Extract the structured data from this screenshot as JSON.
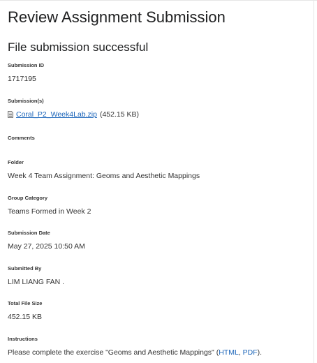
{
  "page": {
    "title": "Review Assignment Submission",
    "subtitle": "File submission successful"
  },
  "submission_id": {
    "label": "Submission ID",
    "value": "1717195"
  },
  "submissions": {
    "label": "Submission(s)",
    "file_icon": "file-icon",
    "file_name": "Coral_P2_Week4Lab.zip",
    "file_size": "(452.15 KB)"
  },
  "comments": {
    "label": "Comments"
  },
  "folder": {
    "label": "Folder",
    "value": "Week 4 Team Assignment: Geoms and Aesthetic Mappings"
  },
  "group_category": {
    "label": "Group Category",
    "value": "Teams Formed in Week 2"
  },
  "submission_date": {
    "label": "Submission Date",
    "value": "May 27, 2025 10:50 AM"
  },
  "submitted_by": {
    "label": "Submitted By",
    "value": "LIM LIANG FAN ."
  },
  "total_file_size": {
    "label": "Total File Size",
    "value": "452.15 KB"
  },
  "instructions": {
    "label": "Instructions",
    "text_before": "Please complete the exercise \"Geoms and Aesthetic Mappings\" (",
    "link_html": "HTML",
    "separator": ", ",
    "link_pdf": "PDF",
    "text_after": ")."
  },
  "colors": {
    "link": "#1a64b9",
    "text": "#202122"
  }
}
